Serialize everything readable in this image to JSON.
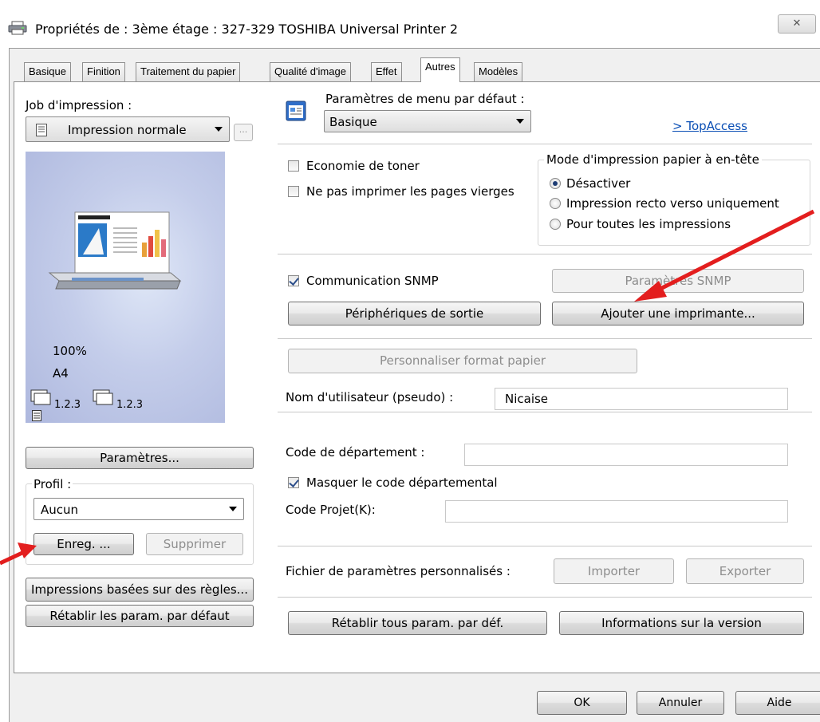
{
  "window": {
    "title": "Propriétés de : 3ème étage : 327-329  TOSHIBA Universal Printer 2",
    "close_icon": "close-x-icon"
  },
  "tabs": [
    {
      "label": "Basique"
    },
    {
      "label": "Finition"
    },
    {
      "label": "Traitement du papier"
    },
    {
      "label": "Qualité d'image"
    },
    {
      "label": "Effet"
    },
    {
      "label": "Autres",
      "active": true
    },
    {
      "label": "Modèles"
    }
  ],
  "left": {
    "job_label": "Job d'impression :",
    "job_value": "Impression normale",
    "job_more": "...",
    "preview": {
      "zoom": "100%",
      "paper": "A4",
      "collate_a": "1.2.3",
      "collate_b": "1.2.3"
    },
    "params_button": "Paramètres...",
    "profile_label": "Profil :",
    "profile_value": "Aucun",
    "save_button": "Enreg. ...",
    "delete_button": "Supprimer",
    "rules_button": "Impressions basées sur des règles...",
    "reset_button": "Rétablir les param. par défaut"
  },
  "right": {
    "menu_label": "Paramètres de menu par défaut :",
    "menu_value": "Basique",
    "topaccess_link": "> TopAccess",
    "toner_label": "Economie de toner",
    "toner_checked": false,
    "blank_label": "Ne pas imprimer les pages vierges",
    "blank_checked": false,
    "letterhead_title": "Mode d'impression papier à en-tête",
    "letterhead_options": [
      {
        "label": "Désactiver",
        "checked": true
      },
      {
        "label": "Impression recto verso uniquement",
        "checked": false
      },
      {
        "label": "Pour toutes les impressions",
        "checked": false
      }
    ],
    "snmp_label": "Communication SNMP",
    "snmp_checked": true,
    "snmp_params_button": "Paramètres SNMP",
    "output_devices_button": "Périphériques de sortie",
    "add_printer_button": "Ajouter une imprimante...",
    "custom_paper_button": "Personnaliser format papier",
    "username_label": "Nom d'utilisateur (pseudo) :",
    "username_value": "Nicaise",
    "dept_code_label": "Code de département :",
    "dept_code_value": "",
    "mask_dept_label": "Masquer le code départemental",
    "mask_dept_checked": true,
    "project_code_label": "Code Projet(K):",
    "project_code_value": "",
    "custom_file_label": "Fichier de paramètres personnalisés :",
    "import_button": "Importer",
    "export_button": "Exporter",
    "reset_all_button": "Rétablir tous param. par déf.",
    "version_button": "Informations sur la version"
  },
  "footer": {
    "ok": "OK",
    "cancel": "Annuler",
    "help": "Aide"
  },
  "colors": {
    "annotation_arrow": "#e31e1e",
    "link": "#0b4fb5"
  }
}
